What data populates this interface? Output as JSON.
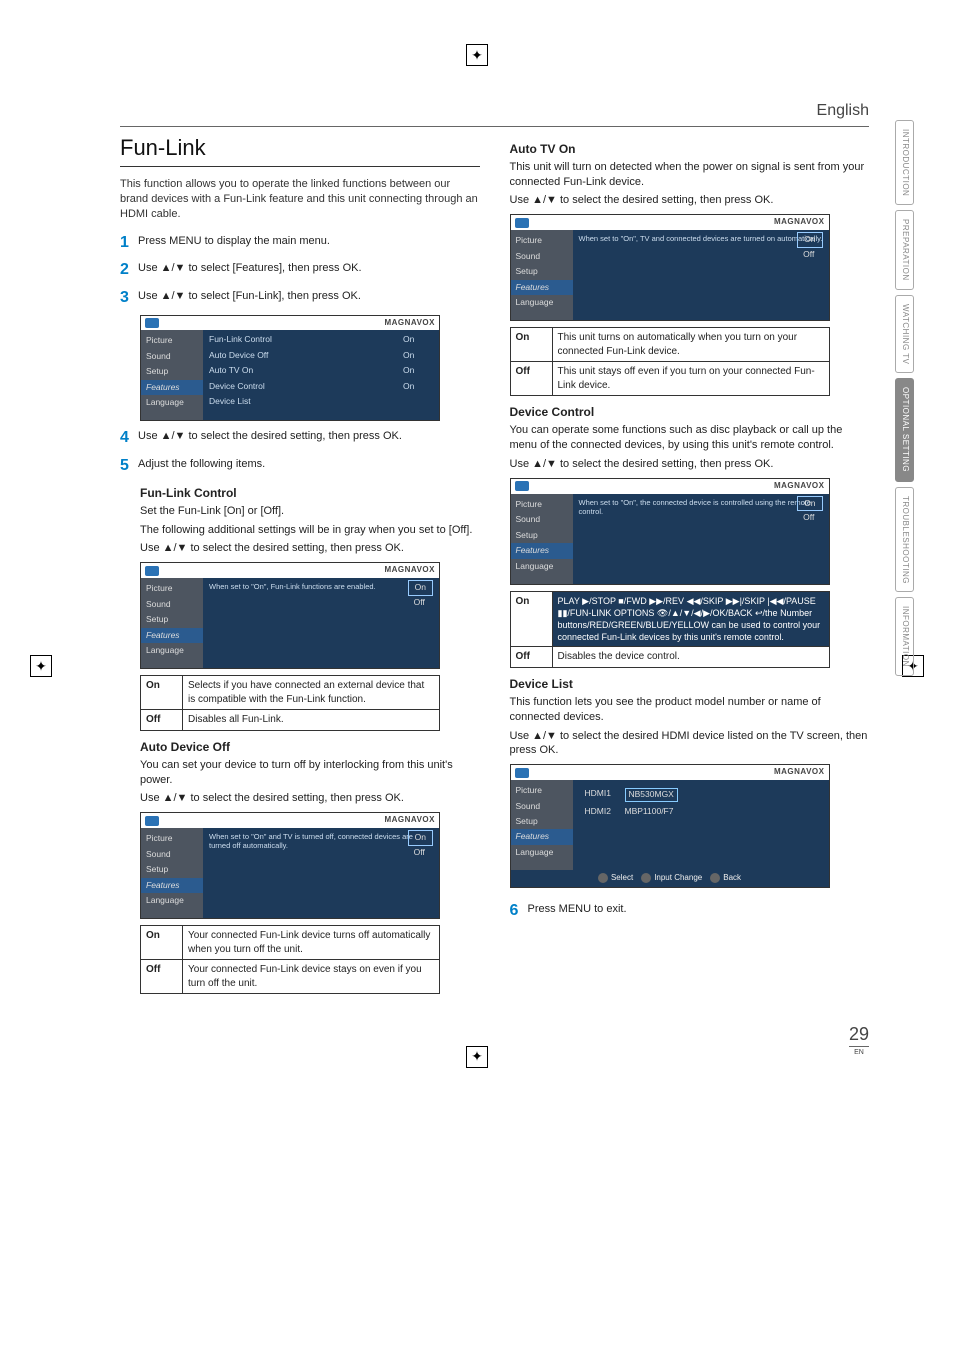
{
  "lang_header": "English",
  "side_tabs": [
    "INTRODUCTION",
    "PREPARATION",
    "WATCHING TV",
    "OPTIONAL SETTING",
    "TROUBLESHOOTING",
    "INFORMATION"
  ],
  "side_tab_active_index": 3,
  "page_number": "29",
  "page_number_sub": "EN",
  "left": {
    "title": "Fun-Link",
    "intro": "This function allows you to operate the linked functions between our brand devices with a Fun-Link feature and this unit connecting through an HDMI cable.",
    "step1": "Press MENU to display the main menu.",
    "step2": "Use ▲/▼ to select [Features], then press OK.",
    "step3": "Use ▲/▼ to select [Fun-Link], then press OK.",
    "step4": "Use ▲/▼ to select the desired setting, then press OK.",
    "step5": "Adjust the following items.",
    "funlink_control_head": "Fun-Link Control",
    "funlink_control_p1": "Set the Fun-Link [On] or [Off].",
    "funlink_control_p2": "The following additional settings will be in gray when you set to [Off].",
    "funlink_control_p3": "Use ▲/▼ to select the desired setting, then press OK.",
    "funlink_table": {
      "on": "Selects if you have connected an external device that is compatible with the Fun-Link function.",
      "off": "Disables all Fun-Link."
    },
    "auto_off_head": "Auto Device Off",
    "auto_off_p1": "You can set your device to turn off by interlocking from this unit's power.",
    "auto_off_p2": "Use ▲/▼ to select the desired setting, then press OK.",
    "auto_off_table": {
      "on": "Your connected Fun-Link device turns off automatically when you turn off the unit.",
      "off": "Your connected Fun-Link device stays on even if you turn off the unit."
    }
  },
  "right": {
    "auto_tv_head": "Auto TV On",
    "auto_tv_p1": "This unit will turn on detected when the power on signal is sent from your connected Fun-Link device.",
    "auto_tv_p2": "Use ▲/▼ to select the desired setting, then press OK.",
    "auto_tv_table": {
      "on": "This unit turns on automatically when you turn on your connected Fun-Link device.",
      "off": "This unit stays off even if you turn on your connected Fun-Link device."
    },
    "dev_ctrl_head": "Device Control",
    "dev_ctrl_p1": "You can operate some functions such as disc playback or call up the menu of the connected devices, by using this unit's remote control.",
    "dev_ctrl_p2": "Use ▲/▼ to select the desired setting, then press OK.",
    "dev_ctrl_table": {
      "on": "PLAY ▶/STOP ■/FWD ▶▶/REV ◀◀/SKIP ▶▶|/SKIP |◀◀/PAUSE ▮▮/FUN-LINK OPTIONS 👁/▲/▼/◀/▶/OK/BACK ↩/the Number buttons/RED/GREEN/BLUE/YELLOW can be used to control your connected Fun-Link devices by this unit's remote control.",
      "off": "Disables the device control."
    },
    "dev_list_head": "Device List",
    "dev_list_p1": "This function lets you see the product model number or name of connected devices.",
    "dev_list_p2": "Use ▲/▼ to select the desired HDMI device listed on the TV screen, then press OK.",
    "step6": "Press MENU to exit."
  },
  "screens": {
    "brand": "MAGNAVOX",
    "side_items": [
      "Picture",
      "Sound",
      "Setup",
      "Features",
      "Language"
    ],
    "main1_rows": [
      {
        "label": "Fun-Link Control",
        "val": "On"
      },
      {
        "label": "Auto Device Off",
        "val": "On"
      },
      {
        "label": "Auto TV On",
        "val": "On"
      },
      {
        "label": "Device Control",
        "val": "On"
      },
      {
        "label": "Device List",
        "val": ""
      }
    ],
    "opt_on": "On",
    "opt_off": "Off",
    "desc_funlink": "When set to \"On\", Fun-Link functions are enabled.",
    "desc_autooff": "When set to \"On\" and TV is turned off, connected devices are turned off automatically.",
    "desc_autotv": "When set to \"On\", TV and connected devices are turned on automatically.",
    "desc_devctrl": "When set to \"On\", the connected device is controlled using the remote control.",
    "devlist_rows": [
      {
        "port": "HDMI1",
        "model": "NB530MGX"
      },
      {
        "port": "HDMI2",
        "model": "MBP1100/F7"
      }
    ],
    "bottom_select": "Select",
    "bottom_input": "Input Change",
    "bottom_back": "Back"
  },
  "labels": {
    "on": "On",
    "off": "Off"
  }
}
